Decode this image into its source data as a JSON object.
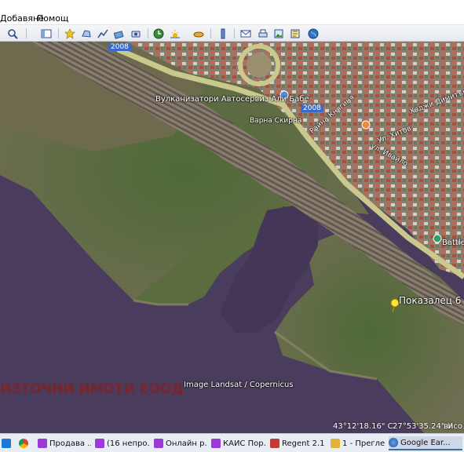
{
  "menu": {
    "add": "Добавяне",
    "help": "Помощ"
  },
  "toolbar": {
    "buttons": [
      "search-icon",
      "sidebar-icon",
      "placemark-icon",
      "polygon-icon",
      "path-icon",
      "overlay-icon",
      "tour-icon",
      "history-icon",
      "sun-icon",
      "planets-icon",
      "ruler-icon",
      "email-icon",
      "print-icon",
      "save-image-icon",
      "map-icon",
      "earth-icon"
    ]
  },
  "map": {
    "labels": {
      "road_2008_top": "2008",
      "road_2008_mid": "2008",
      "autoservice": "Вулканизатори Автосервиз Али Бабе",
      "street_vaska": "Варна Скирна",
      "street_a": "Ул. Хитов",
      "street_b": "ул. Ивайло",
      "street_c": "Хаджи Димитър",
      "street_d": "Райна Княгиня",
      "battle": "Battle",
      "placemark": "Показалец 6",
      "watermark": "ИЗТОЧНИ ИМОТИ ЕООД",
      "imagery": "Image Landsat / Copernicus"
    },
    "status": {
      "lat": "43°12'18.16\" С",
      "lon": "27°53'35.24\" И",
      "alt": "висо"
    }
  },
  "taskbar": {
    "items": [
      {
        "label": "",
        "icon": "windows-icon"
      },
      {
        "label": "",
        "icon": "chrome-icon"
      },
      {
        "label": "Продава ...",
        "icon": "app-icon"
      },
      {
        "label": "(16 непро...",
        "icon": "app-icon"
      },
      {
        "label": "Онлайн р...",
        "icon": "app-icon"
      },
      {
        "label": "КАИС Пор...",
        "icon": "app-icon"
      },
      {
        "label": "Regent 2.1 ...",
        "icon": "regent-icon"
      },
      {
        "label": "1 - Прегле...",
        "icon": "folder-icon"
      },
      {
        "label": "Google Ear...",
        "icon": "google-earth-icon"
      }
    ]
  },
  "colors": {
    "water": "#4a3c5c",
    "land": "#6b6a4a",
    "urban": "#8a7d72",
    "railway": "#7a6f63",
    "road": "#c9c98d"
  }
}
